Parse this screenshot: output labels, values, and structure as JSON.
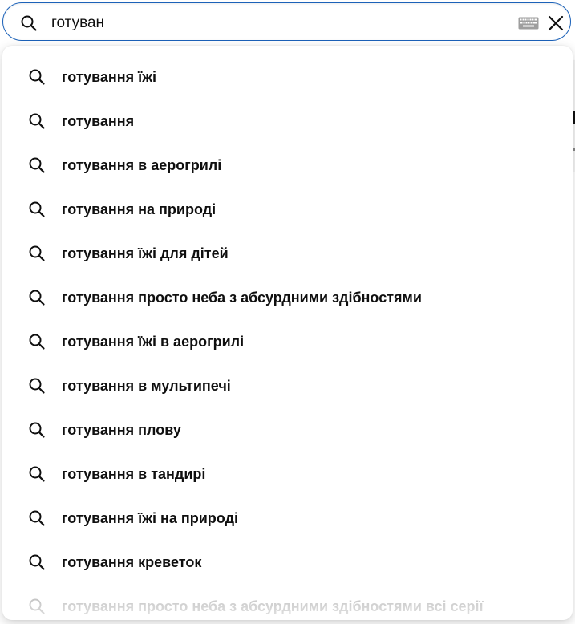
{
  "search": {
    "query": "готуван",
    "icons": {
      "search": "search-icon",
      "keyboard": "keyboard-icon",
      "clear": "close-icon"
    }
  },
  "suggestions": [
    "готування їжі",
    "готування",
    "готування в аерогрилі",
    "готування на природі",
    "готування їжі для дітей",
    "готування просто неба з абсурдними здібностями",
    "готування їжі в аерогрилі",
    "готування в мультипечі",
    "готування плову",
    "готування в тандирі",
    "готування їжі на природі",
    "готування креветок",
    "готування просто неба з абсурдними здібностями всі серії"
  ],
  "colors": {
    "focus_border": "#1c62b9",
    "text": "#0f0f0f",
    "faded_text": "#bdbdbd"
  }
}
